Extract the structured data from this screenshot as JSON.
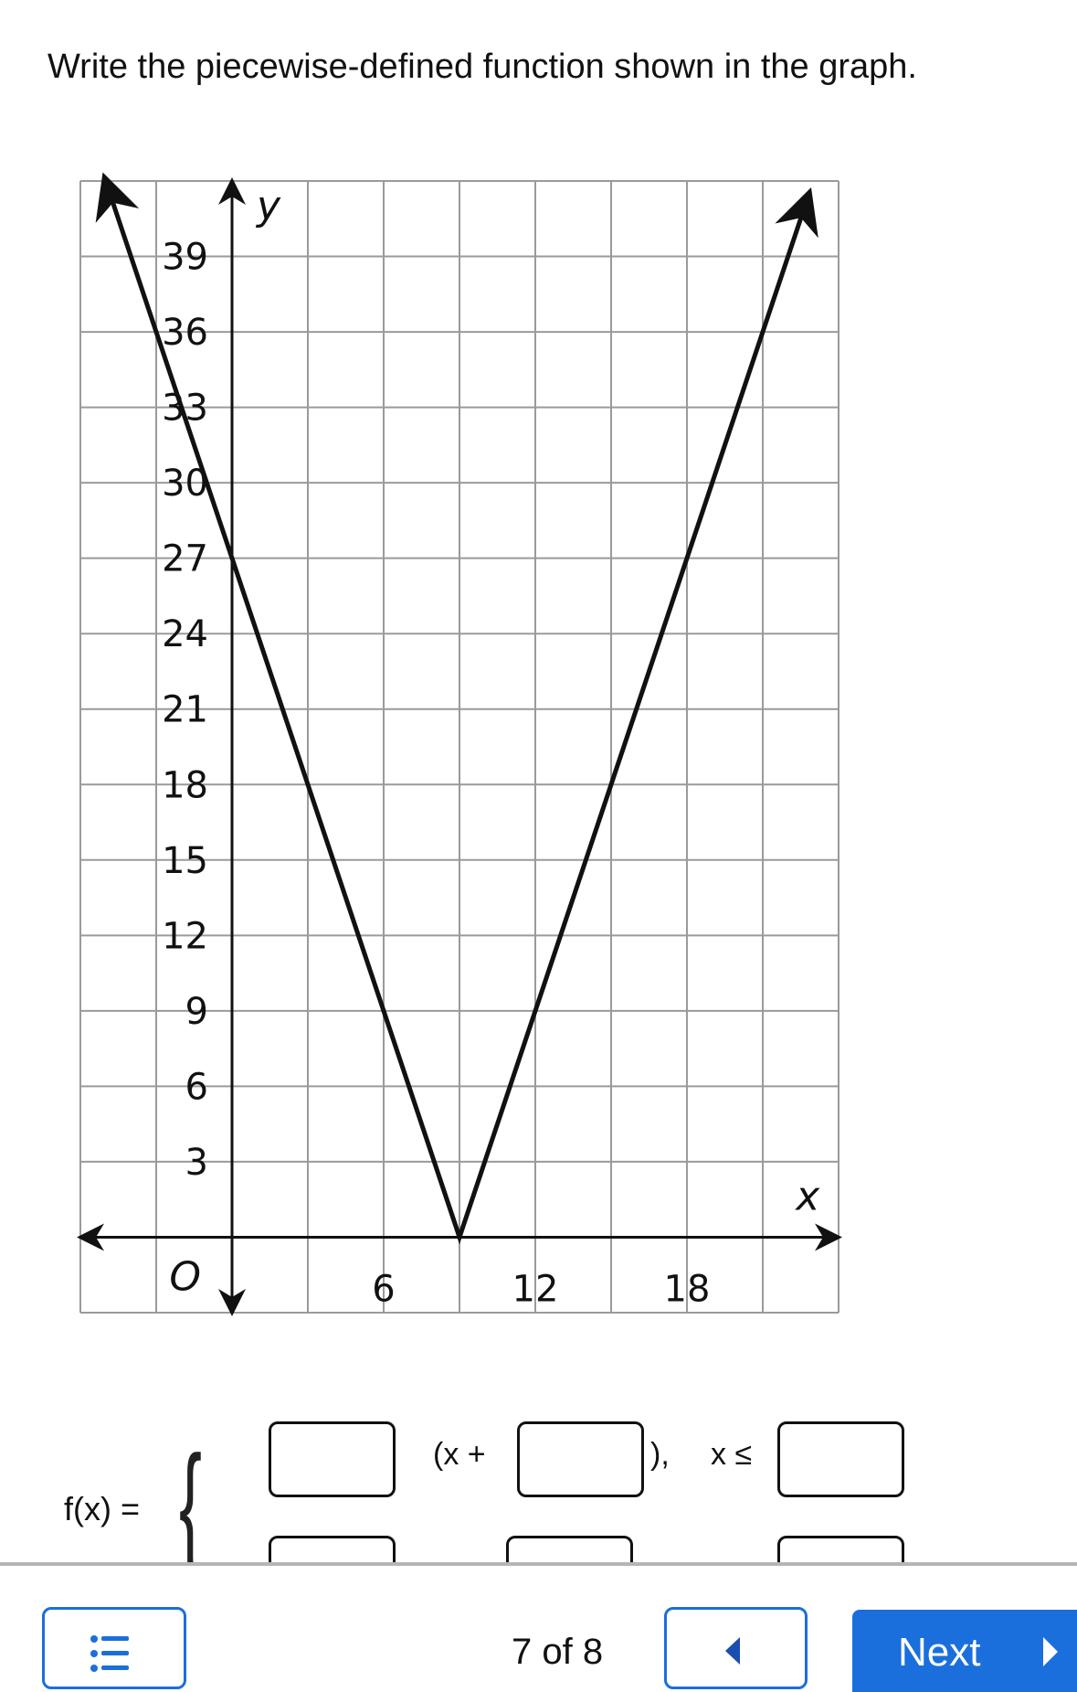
{
  "question": {
    "title": "Write the piecewise-defined function shown in the graph."
  },
  "chart_data": {
    "type": "line",
    "title": "",
    "xlabel": "x",
    "ylabel": "y",
    "origin_label": "O",
    "xlim": [
      -6,
      24
    ],
    "ylim": [
      -3,
      42
    ],
    "x_grid_step": 3,
    "y_grid_step": 3,
    "grid": true,
    "x_tick_labels": [
      "6",
      "12",
      "18"
    ],
    "x_ticks": [
      6,
      12,
      18
    ],
    "y_tick_labels": [
      "3",
      "6",
      "9",
      "12",
      "15",
      "18",
      "21",
      "24",
      "27",
      "30",
      "33",
      "36",
      "39"
    ],
    "y_ticks": [
      3,
      6,
      9,
      12,
      15,
      18,
      21,
      24,
      27,
      30,
      33,
      36,
      39
    ],
    "series": [
      {
        "points": [
          [
            -5,
            42
          ],
          [
            9,
            0
          ],
          [
            22.8,
            41.4
          ]
        ],
        "arrows_both_ends": true,
        "color": "#111111"
      }
    ]
  },
  "formula": {
    "lhs": "f(x) =",
    "row1": {
      "open": "(x +",
      "close": "),",
      "condition": "x ≤"
    },
    "row1_inputs": [
      "",
      "",
      ""
    ],
    "row2_inputs": [
      "",
      "",
      ""
    ]
  },
  "nav": {
    "list_icon": "list-icon",
    "counter": "7 of 8",
    "prev_icon": "triangle-left-icon",
    "next_label": "Next",
    "next_icon": "triangle-right-icon",
    "accent": "#1a6fdc"
  }
}
